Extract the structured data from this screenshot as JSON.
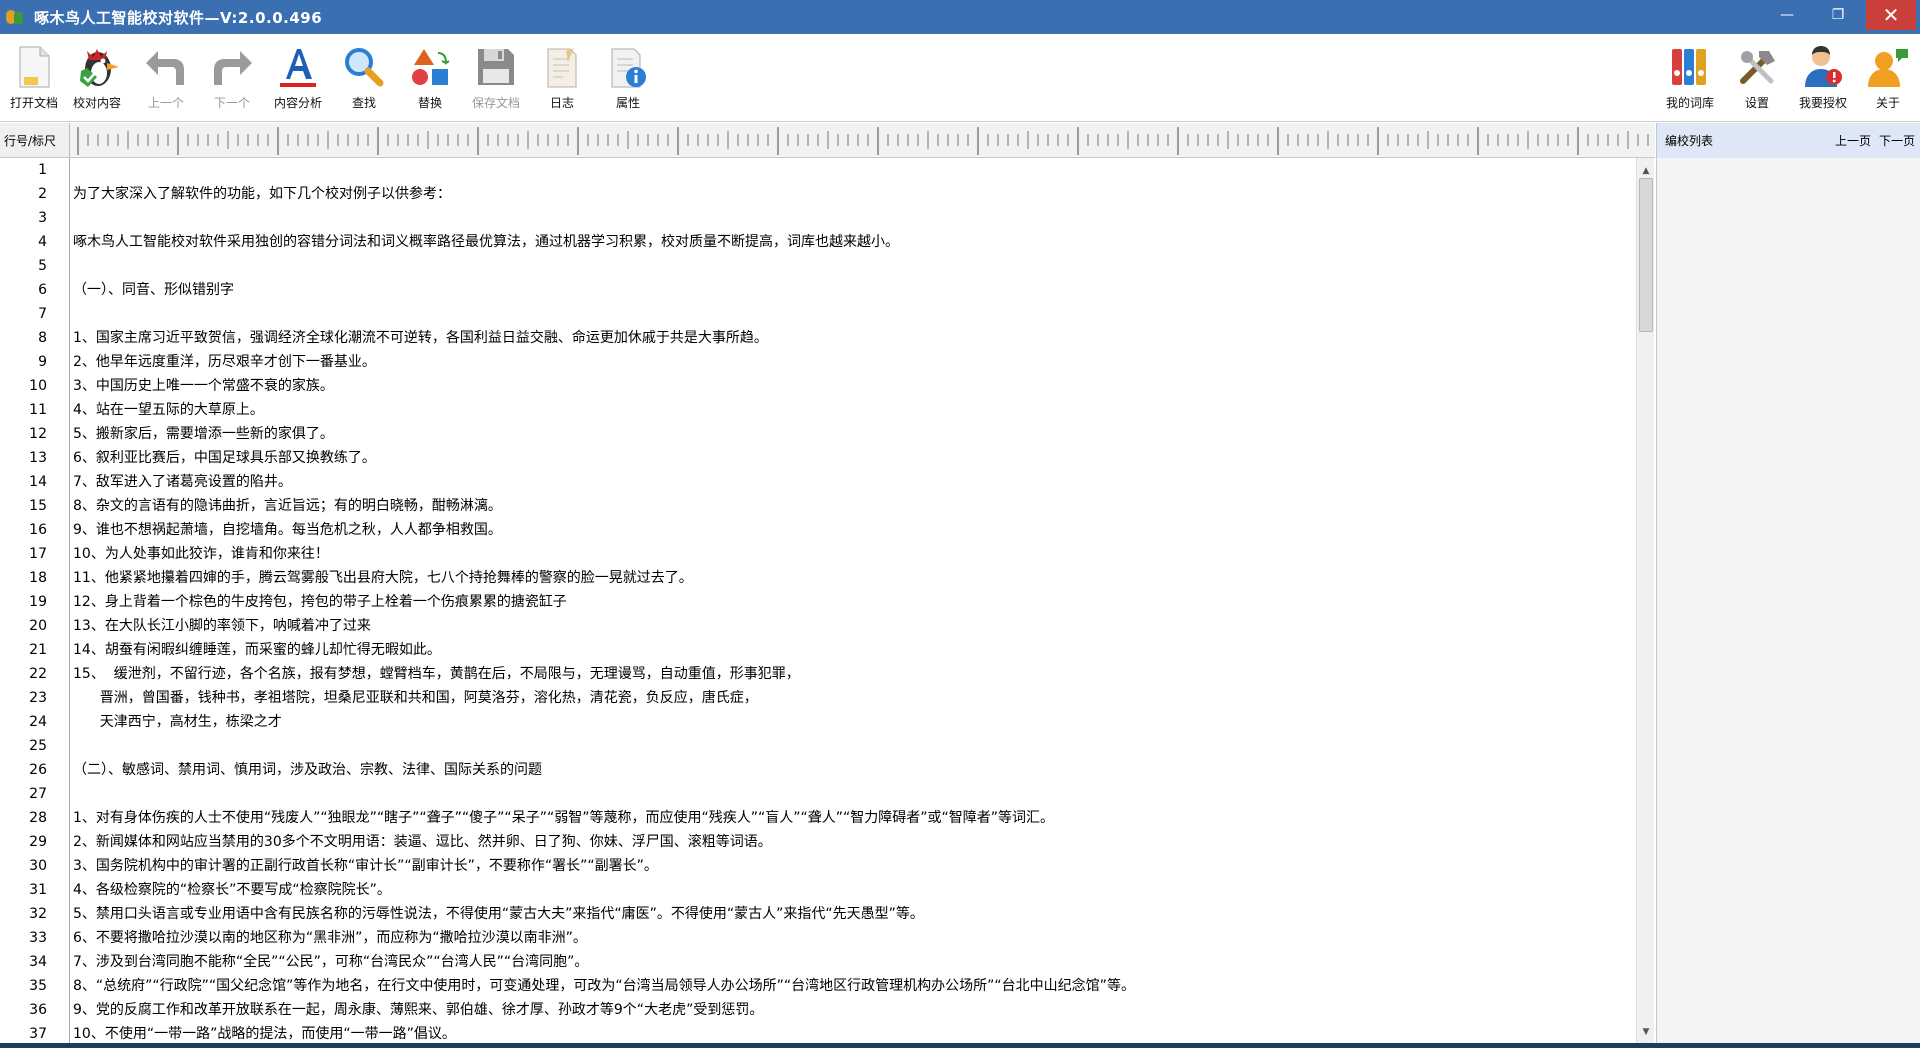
{
  "window": {
    "title": "啄木鸟人工智能校对软件—V:2.0.0.496",
    "minimize_glyph": "—",
    "maximize_glyph": "❐",
    "close_glyph": "✕"
  },
  "toolbar": {
    "left": [
      {
        "label": "打开文档",
        "icon": "open-document-icon",
        "enabled": true
      },
      {
        "label": "校对内容",
        "icon": "proofread-bird-icon",
        "enabled": true
      },
      {
        "label": "上一个",
        "icon": "previous-arrow-icon",
        "enabled": false
      },
      {
        "label": "下一个",
        "icon": "next-arrow-icon",
        "enabled": false
      },
      {
        "label": "内容分析",
        "icon": "content-analysis-icon",
        "enabled": true
      },
      {
        "label": "查找",
        "icon": "search-icon",
        "enabled": true
      },
      {
        "label": "替换",
        "icon": "replace-icon",
        "enabled": true
      },
      {
        "label": "保存文档",
        "icon": "save-icon",
        "enabled": false
      },
      {
        "label": "日志",
        "icon": "log-icon",
        "enabled": true
      },
      {
        "label": "属性",
        "icon": "properties-icon",
        "enabled": true
      }
    ],
    "right": [
      {
        "label": "我的词库",
        "icon": "dictionary-icon",
        "enabled": true
      },
      {
        "label": "设置",
        "icon": "settings-tools-icon",
        "enabled": true
      },
      {
        "label": "我要授权",
        "icon": "authorize-user-icon",
        "enabled": true
      },
      {
        "label": "关于",
        "icon": "about-user-icon",
        "enabled": true
      }
    ]
  },
  "gutter_header": "行号/标尺",
  "side_panel": {
    "title": "编校列表",
    "prev_label": "上一页",
    "next_label": "下一页"
  },
  "lines": [
    {
      "n": "1",
      "text": ""
    },
    {
      "n": "2",
      "text": "为了大家深入了解软件的功能，如下几个校对例子以供参考："
    },
    {
      "n": "3",
      "text": ""
    },
    {
      "n": "4",
      "text": "啄木鸟人工智能校对软件采用独创的容错分词法和词义概率路径最优算法，通过机器学习积累，校对质量不断提高，词库也越来越小。"
    },
    {
      "n": "5",
      "text": ""
    },
    {
      "n": "6",
      "text": "（一）、同音、形似错别字"
    },
    {
      "n": "7",
      "text": ""
    },
    {
      "n": "8",
      "text": "1、国家主席习近平致贺信，强调经济全球化潮流不可逆转，各国利益日益交融、命运更加休戚于共是大事所趋。"
    },
    {
      "n": "9",
      "text": "2、他早年远度重洋，历尽艰辛才创下一番基业。"
    },
    {
      "n": "10",
      "text": "3、中国历史上唯一一个常盛不衰的家族。"
    },
    {
      "n": "11",
      "text": "4、站在一望五际的大草原上。"
    },
    {
      "n": "12",
      "text": "5、搬新家后，需要增添一些新的家俱了。"
    },
    {
      "n": "13",
      "text": "6、叙利亚比赛后，中国足球具乐部又换教练了。"
    },
    {
      "n": "14",
      "text": "7、敌军进入了诸葛亮设置的陷井。"
    },
    {
      "n": "15",
      "text": "8、杂文的言语有的隐讳曲折，言近旨远；有的明白晓畅，酣畅淋漓。"
    },
    {
      "n": "16",
      "text": "9、谁也不想祸起萧墙，自挖墙角。每当危机之秋，人人都争相救国。"
    },
    {
      "n": "17",
      "text": "10、为人处事如此狡诈，谁肯和你来往！"
    },
    {
      "n": "18",
      "text": "11、他紧紧地攥着四婶的手，腾云驾雾般飞出县府大院，七八个持抢舞棒的警察的脸一晃就过去了。"
    },
    {
      "n": "19",
      "text": "12、身上背着一个棕色的牛皮挎包，挎包的带子上栓着一个伤痕累累的搪瓷缸子"
    },
    {
      "n": "20",
      "text": "13、在大队长江小脚的率领下，呐喊着冲了过来"
    },
    {
      "n": "21",
      "text": "14、胡蚕有闲暇纠缠睡莲，而采蜜的蜂儿却忙得无暇如此。"
    },
    {
      "n": "22",
      "text": "15、  缓泄剂，不留行迹，各个名族，报有梦想，螳臂档车，黄鹊在后，不局限与，无理谩骂，自动重值，形事犯罪，"
    },
    {
      "n": "23",
      "text": "      晋洲，曾国番，钱种书，孝祖塔院，坦桑尼亚联和共和国，阿莫洛芬，溶化热，清花瓷，负反应，唐氏症，"
    },
    {
      "n": "24",
      "text": "      天津西宁，高材生，栋梁之才"
    },
    {
      "n": "25",
      "text": ""
    },
    {
      "n": "26",
      "text": "（二）、敏感词、禁用词、慎用词，涉及政治、宗教、法律、国际关系的问题"
    },
    {
      "n": "27",
      "text": ""
    },
    {
      "n": "28",
      "text": "1、对有身体伤疾的人士不使用“残废人”“独眼龙”“瞎子”“聋子”“傻子”“呆子”“弱智”等蔑称，而应使用“残疾人”“盲人”“聋人”“智力障碍者”或“智障者”等词汇。"
    },
    {
      "n": "29",
      "text": "2、新闻媒体和网站应当禁用的30多个不文明用语：装逼、逗比、然并卵、日了狗、你妹、浮尸国、滚粗等词语。"
    },
    {
      "n": "30",
      "text": "3、国务院机构中的审计署的正副行政首长称“审计长”“副审计长”，不要称作“署长”“副署长”。"
    },
    {
      "n": "31",
      "text": "4、各级检察院的“检察长”不要写成“检察院院长”。"
    },
    {
      "n": "32",
      "text": "5、禁用口头语言或专业用语中含有民族名称的污辱性说法，不得使用“蒙古大夫”来指代“庸医”。不得使用“蒙古人”来指代“先天愚型”等。"
    },
    {
      "n": "33",
      "text": "6、不要将撒哈拉沙漠以南的地区称为“黑非洲”，而应称为“撒哈拉沙漠以南非洲”。"
    },
    {
      "n": "34",
      "text": "7、涉及到台湾同胞不能称“全民”“公民”，可称“台湾民众”“台湾人民”“台湾同胞”。"
    },
    {
      "n": "35",
      "text": "8、“总统府”“行政院”“国父纪念馆”等作为地名，在行文中使用时，可变通处理，可改为“台湾当局领导人办公场所”“台湾地区行政管理机构办公场所”“台北中山纪念馆”等。"
    },
    {
      "n": "36",
      "text": "9、党的反腐工作和改革开放联系在一起，周永康、薄熙来、郭伯雄、徐才厚、孙政才等9个“大老虎”受到惩罚。"
    },
    {
      "n": "37",
      "text": "10、不使用“一带一路”战略的提法，而使用“一带一路”倡议。"
    }
  ],
  "scrollbar": {
    "position_fraction": 0.0
  },
  "colors": {
    "titlebar": "#3a6fb2",
    "close_button": "#c9403a",
    "side_header": "#dde7f5"
  }
}
